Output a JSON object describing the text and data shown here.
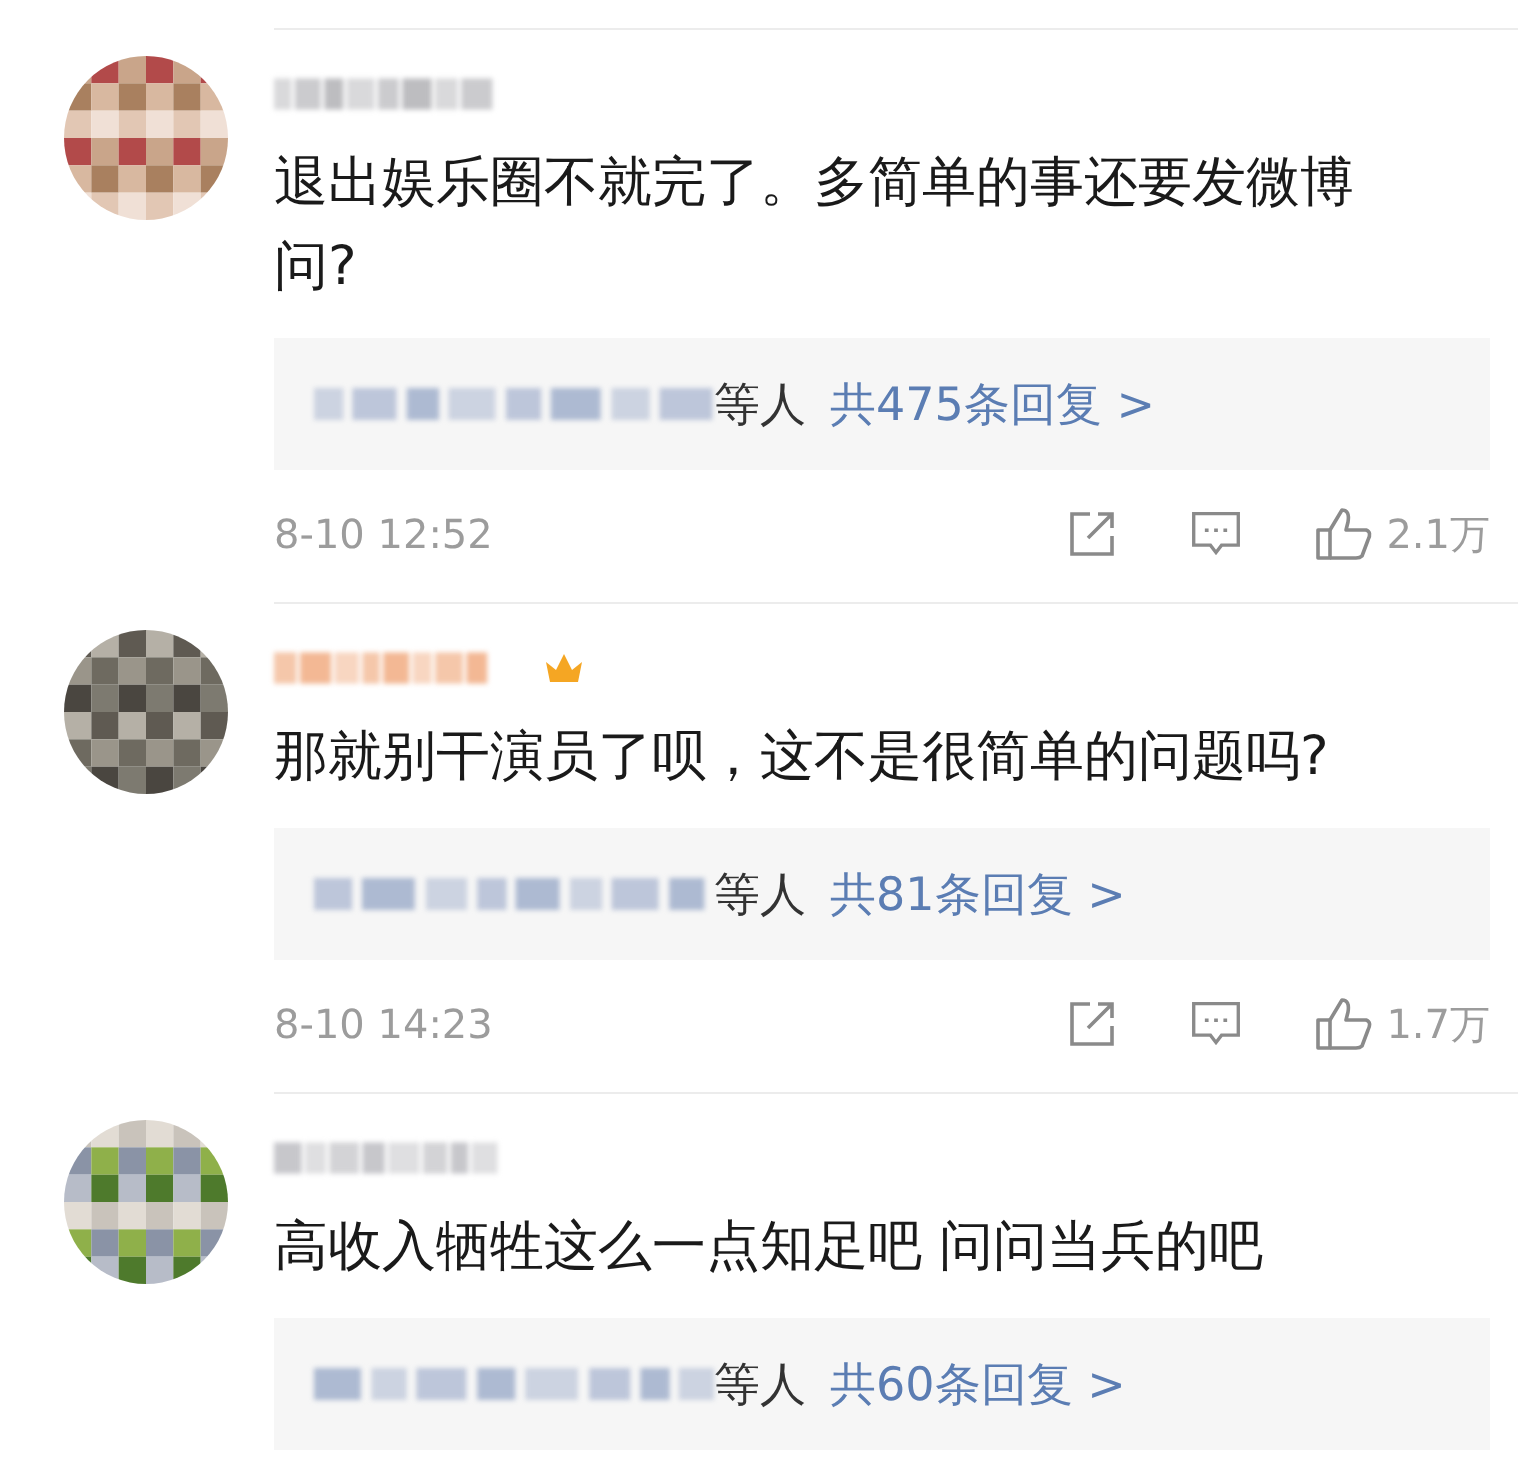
{
  "comments": [
    {
      "user": {
        "color": "#b9b9bd",
        "vip": false
      },
      "text": "退出娱乐圈不就完了。多简单的事还要发微博问?",
      "replies": {
        "suffix": "等人",
        "link": "共475条回复 >"
      },
      "footer": {
        "time": "8-10 12:52",
        "likes": "2.1万"
      }
    },
    {
      "user": {
        "color": "#f2b48e",
        "vip": true
      },
      "text": "那就别干演员了呗，这不是很简单的问题吗?",
      "replies": {
        "suffix": "等人",
        "link": "共81条回复 >"
      },
      "footer": {
        "time": "8-10 14:23",
        "likes": "1.7万"
      }
    },
    {
      "user": {
        "color": "#c4c4c8",
        "vip": false
      },
      "text": "高收入牺牲这么一点知足吧  问问当兵的吧",
      "replies": {
        "suffix": "等人",
        "link": "共60条回复 >"
      }
    }
  ]
}
